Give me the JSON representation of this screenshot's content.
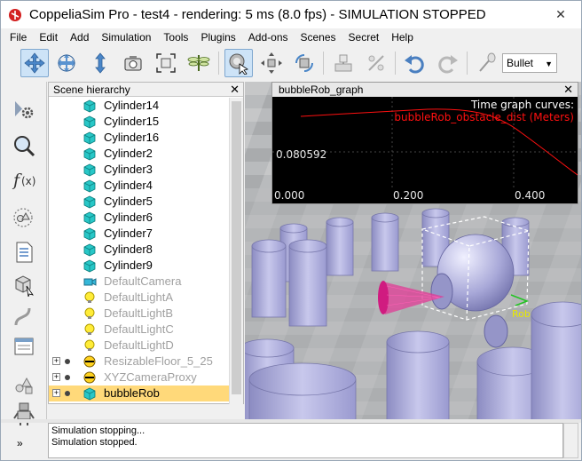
{
  "window": {
    "app_name": "CoppeliaSim Pro",
    "title": "CoppeliaSim Pro  -  test4 - rendering: 5 ms (8.0 fps) - SIMULATION STOPPED",
    "close_glyph": "✕"
  },
  "menu": [
    "File",
    "Edit",
    "Add",
    "Simulation",
    "Tools",
    "Plugins",
    "Add-ons",
    "Scenes",
    "Secret",
    "Help"
  ],
  "toolbar": {
    "buttons": [
      "move-camera-icon",
      "rotate-camera-icon",
      "zoom-camera-icon",
      "camera-fit-icon",
      "fit-view-icon",
      "dragonfly-icon",
      "click-select-icon",
      "object-shift-icon",
      "object-rotate-icon",
      "assemble-icon",
      "transfer-dna-icon",
      "undo-icon",
      "redo-icon",
      "dynamics-toggle-icon"
    ],
    "physics_engine": "Bullet"
  },
  "left_tools": [
    "simulation-settings-icon",
    "selection-icon",
    "script-icon",
    "collections-icon",
    "page-icon",
    "model-browser-icon",
    "path-icon",
    "user-settings-icon",
    "scene-objects-icon",
    "robot-icon"
  ],
  "hierarchy": {
    "title": "Scene hierarchy",
    "close_glyph": "✕",
    "items": [
      {
        "label": "Cylinder14",
        "type": "shape",
        "state": "normal"
      },
      {
        "label": "Cylinder15",
        "type": "shape",
        "state": "normal"
      },
      {
        "label": "Cylinder16",
        "type": "shape",
        "state": "normal"
      },
      {
        "label": "Cylinder2",
        "type": "shape",
        "state": "normal"
      },
      {
        "label": "Cylinder3",
        "type": "shape",
        "state": "normal"
      },
      {
        "label": "Cylinder4",
        "type": "shape",
        "state": "normal"
      },
      {
        "label": "Cylinder5",
        "type": "shape",
        "state": "normal"
      },
      {
        "label": "Cylinder6",
        "type": "shape",
        "state": "normal"
      },
      {
        "label": "Cylinder7",
        "type": "shape",
        "state": "normal"
      },
      {
        "label": "Cylinder8",
        "type": "shape",
        "state": "normal"
      },
      {
        "label": "Cylinder9",
        "type": "shape",
        "state": "normal"
      },
      {
        "label": "DefaultCamera",
        "type": "camera",
        "state": "grey"
      },
      {
        "label": "DefaultLightA",
        "type": "light",
        "state": "grey"
      },
      {
        "label": "DefaultLightB",
        "type": "light",
        "state": "grey"
      },
      {
        "label": "DefaultLightC",
        "type": "light",
        "state": "grey"
      },
      {
        "label": "DefaultLightD",
        "type": "light",
        "state": "grey"
      },
      {
        "label": "ResizableFloor_5_25",
        "type": "model",
        "state": "grey",
        "expandable": true,
        "expand_glyph": "+"
      },
      {
        "label": "XYZCameraProxy",
        "type": "model",
        "state": "grey",
        "expandable": true,
        "expand_glyph": "+"
      },
      {
        "label": "bubbleRob",
        "type": "shape",
        "state": "selected",
        "expandable": true,
        "expand_glyph": "+"
      }
    ]
  },
  "graph": {
    "title": "bubbleRob_graph",
    "close_glyph": "✕",
    "header_text": "Time graph curves:",
    "curve_label": "bubbleRob_obstacle_dist (Meters)",
    "y_tick": "0.080592",
    "x_ticks": [
      "0.000",
      "0.200",
      "0.400"
    ],
    "curve_color": "#ff1010"
  },
  "console": {
    "lines": [
      "Simulation stopping...",
      "Simulation stopped."
    ]
  },
  "colors": {
    "selection": "#ffd97a",
    "toolbar_active": "#cde3f7",
    "shape_icon": "#28c7c7"
  }
}
